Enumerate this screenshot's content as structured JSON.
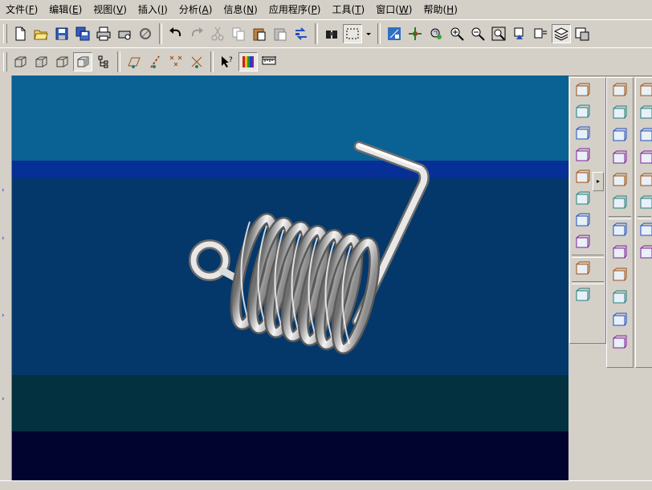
{
  "menu": [
    {
      "label": "文件",
      "key": "F"
    },
    {
      "label": "编辑",
      "key": "E"
    },
    {
      "label": "视图",
      "key": "V"
    },
    {
      "label": "插入",
      "key": "I"
    },
    {
      "label": "分析",
      "key": "A"
    },
    {
      "label": "信息",
      "key": "N"
    },
    {
      "label": "应用程序",
      "key": "P"
    },
    {
      "label": "工具",
      "key": "T"
    },
    {
      "label": "窗口",
      "key": "W"
    },
    {
      "label": "帮助",
      "key": "H"
    }
  ],
  "toolbar1": {
    "icons": [
      "new-file-icon",
      "open-folder-icon",
      "save-icon",
      "save-all-icon",
      "print-icon",
      "plot-icon",
      "model-icon",
      "undo-icon",
      "redo-icon",
      "cut-icon",
      "copy-icon",
      "paste-icon",
      "paste-special-icon",
      "regenerate-icon",
      "find-icon",
      "select-box-icon",
      "datum-display-icon",
      "spin-center-icon",
      "orient-icon",
      "zoom-in-icon",
      "zoom-out-icon",
      "refit-icon",
      "repaint-icon",
      "saved-views-icon",
      "layers-icon",
      "view-manager-icon"
    ]
  },
  "toolbar2": {
    "icons": [
      "wireframe-icon",
      "hidden-line-icon",
      "no-hidden-icon",
      "shading-icon",
      "model-tree-icon",
      "datum-plane-display-icon",
      "datum-axis-display-icon",
      "datum-point-display-icon",
      "coord-sys-display-icon",
      "context-help-icon",
      "color-appearance-icon",
      "measure-icon"
    ]
  },
  "viewport": {
    "colors": {
      "top": "#0a6193",
      "stripe": "#062f98",
      "middle": "#05386a",
      "lower": "#03313f",
      "bottom": "#020430"
    }
  },
  "right_palette_1": [
    "sketch-curve-icon",
    "datum-plane-icon",
    "datum-axis-icon",
    "datum-curve-icon",
    "datum-point-icon",
    "sketched-point-icon",
    "offset-point-icon",
    "datum-analysis-icon",
    "coord-sys-icon",
    "annotation-icon"
  ],
  "right_palette_2": [
    "extrude-icon",
    "revolve-icon",
    "variable-section-sweep-icon",
    "blend-icon",
    "sweep-icon",
    "swept-blend-icon",
    "hole-icon",
    "shell-icon",
    "rib-icon",
    "draft-icon",
    "round-icon",
    "chamfer-icon"
  ],
  "right_palette_3": [
    "pattern-icon",
    "mirror-icon",
    "merge-icon",
    "trim-icon",
    "offset-icon",
    "thicken-icon",
    "solidify-icon",
    "warp-icon"
  ]
}
